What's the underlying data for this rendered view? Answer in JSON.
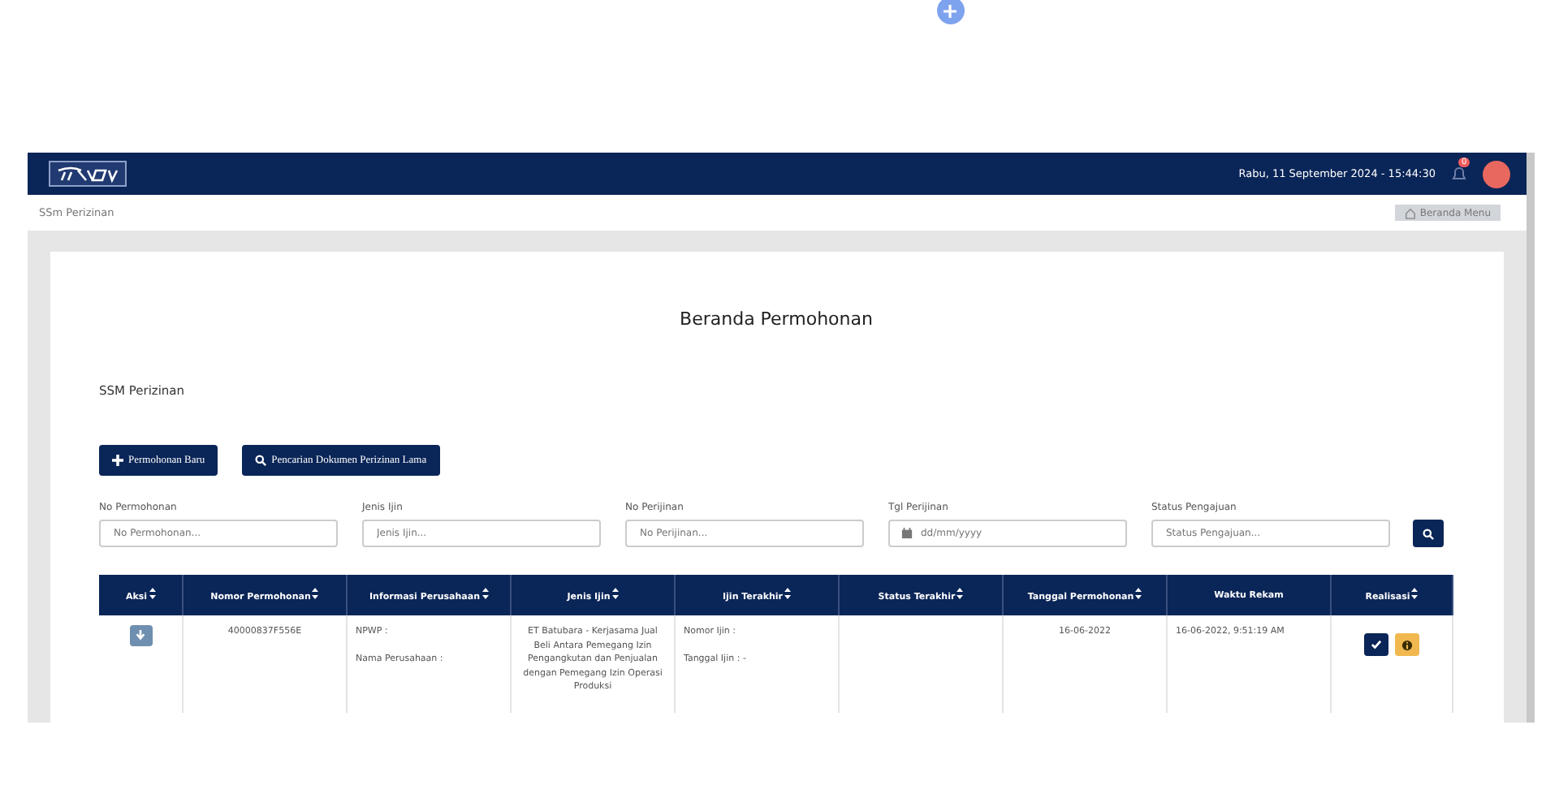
{
  "header": {
    "datetime": "Rabu, 11 September 2024 - 15:44:30",
    "notification_count": "0"
  },
  "breadcrumb": {
    "label": "SSm Perizinan",
    "home_button": "Beranda Menu"
  },
  "page": {
    "title": "Beranda Permohonan",
    "subtitle": "SSM Perizinan"
  },
  "actions": [
    {
      "label": "Permohonan Baru",
      "kind": "plus"
    },
    {
      "label": "Pencarian Dokumen Perizinan Lama",
      "kind": "search"
    }
  ],
  "filters": [
    {
      "label": "No Permohonan",
      "placeholder": "No Permohonan...",
      "kind": "text"
    },
    {
      "label": "Jenis Ijin",
      "placeholder": "Jenis Ijin...",
      "kind": "text"
    },
    {
      "label": "No Perijinan",
      "placeholder": "No Perijinan...",
      "kind": "text"
    },
    {
      "label": "Tgl Perijinan",
      "placeholder": "dd/mm/yyyy",
      "kind": "date"
    },
    {
      "label": "Status Pengajuan",
      "placeholder": "Status Pengajuan...",
      "kind": "text"
    }
  ],
  "table": {
    "columns": [
      {
        "label": "Aksi",
        "sortable": true
      },
      {
        "label": "Nomor Permohonan",
        "sortable": true
      },
      {
        "label": "Informasi Perusahaan",
        "sortable": true
      },
      {
        "label": "Jenis Ijin",
        "sortable": true
      },
      {
        "label": "Ijin Terakhir",
        "sortable": true
      },
      {
        "label": "Status Terakhir",
        "sortable": true
      },
      {
        "label": "Tanggal Permohonan",
        "sortable": true
      },
      {
        "label": "Waktu Rekam",
        "sortable": false
      },
      {
        "label": "Realisasi",
        "sortable": true
      }
    ],
    "rows": [
      {
        "nomor": "40000837F556E",
        "informasi": [
          "NPWP :",
          "Nama Perusahaan :"
        ],
        "jenis": "ET Batubara - Kerjasama Jual Beli Antara Pemegang Izin Pengangkutan dan Penjualan dengan Pemegang Izin Operasi Produksi",
        "ijin_terakhir": [
          "Nomor Ijin :",
          "Tanggal Ijin : -"
        ],
        "tanggal": "16-06-2022",
        "waktu": "16-06-2022, 9:51:19 AM"
      }
    ]
  }
}
